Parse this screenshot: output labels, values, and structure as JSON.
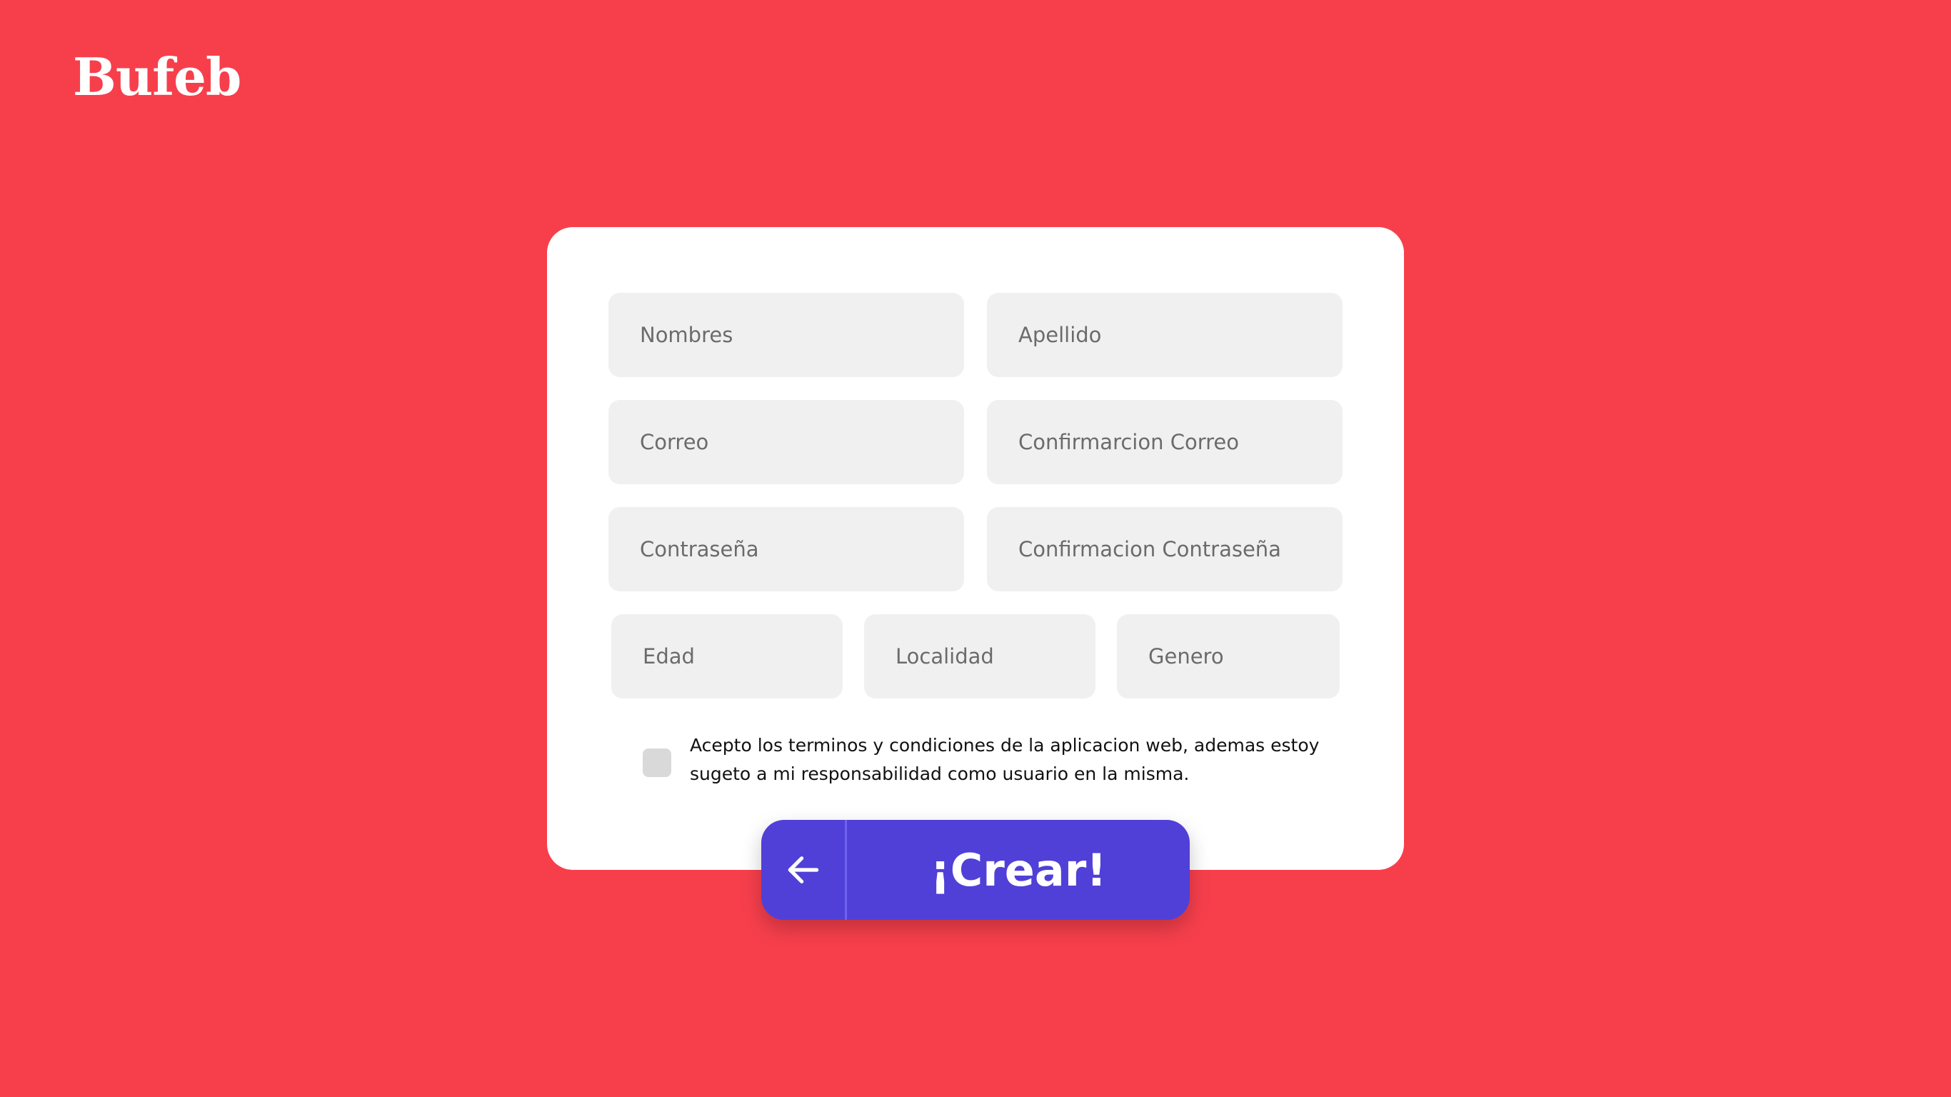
{
  "brand": {
    "name": "Bufeb"
  },
  "form": {
    "fields": {
      "nombres": "Nombres",
      "apellido": "Apellido",
      "correo": "Correo",
      "confirmacion_correo": "Confirmarcion Correo",
      "contrasena": "Contraseña",
      "confirmacion_contrasena": "Confirmacion Contraseña",
      "edad": "Edad",
      "localidad": "Localidad",
      "genero": "Genero"
    },
    "terms_text": "Acepto los terminos y condiciones de la aplicacion web, ademas estoy sugeto a mi responsabilidad como usuario en la misma.",
    "terms_checked": false
  },
  "actions": {
    "back_icon": "arrow-left-icon",
    "create_label": "¡Crear!"
  },
  "colors": {
    "background": "#F73F4C",
    "card": "#FFFFFF",
    "field": "#F0F0F0",
    "button": "#5040D8"
  }
}
